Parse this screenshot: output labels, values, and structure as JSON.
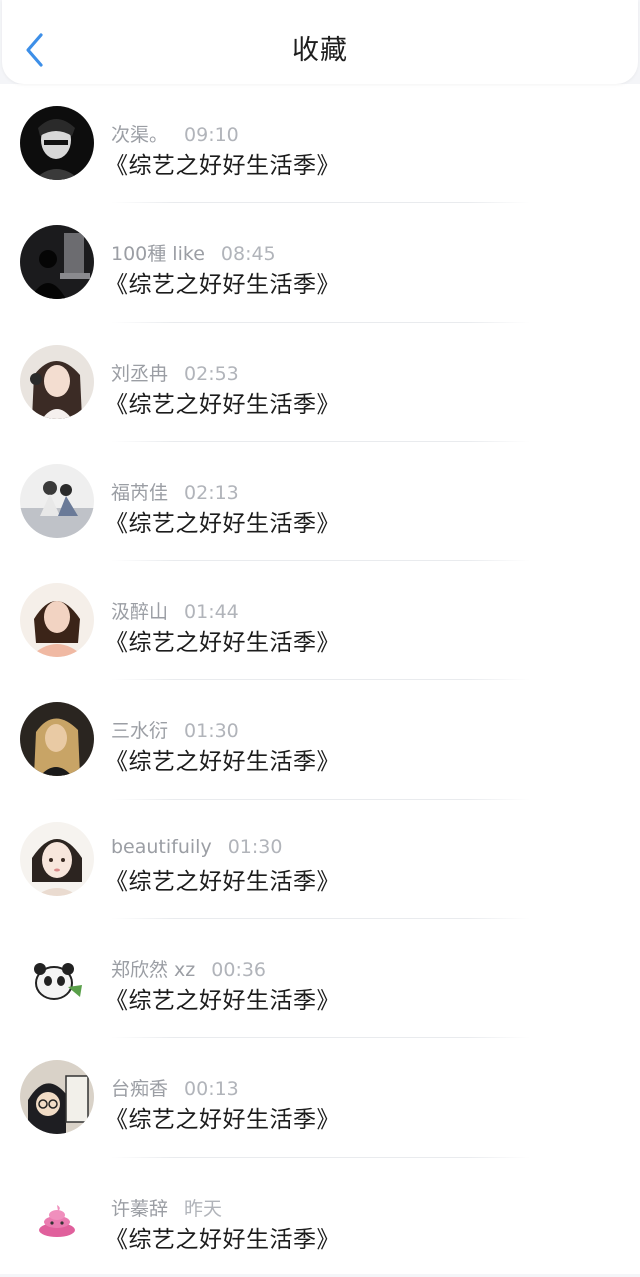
{
  "header": {
    "title": "收藏",
    "back_icon": "chevron-left-icon",
    "accent": "#3d8fe8"
  },
  "items": [
    {
      "name": "次渠。",
      "time": "09:10",
      "subject": "《综艺之好好生活季》",
      "avatar": "avatar-dark-boy"
    },
    {
      "name": "100種 like",
      "time": "08:45",
      "subject": "《综艺之好好生活季》",
      "avatar": "avatar-dark-silhouette"
    },
    {
      "name": "刘丞冉",
      "time": "02:53",
      "subject": "《综艺之好好生活季》",
      "avatar": "avatar-girl-headphones"
    },
    {
      "name": "福芮佳",
      "time": "02:13",
      "subject": "《综艺之好好生活季》",
      "avatar": "avatar-couple-sitting"
    },
    {
      "name": "汲醉山",
      "time": "01:44",
      "subject": "《综艺之好好生活季》",
      "avatar": "avatar-woman-smile"
    },
    {
      "name": "三水衍",
      "time": "01:30",
      "subject": "《综艺之好好生活季》",
      "avatar": "avatar-girl-dark"
    },
    {
      "name": "beautifuily",
      "time": "01:30",
      "subject": "《综艺之好好生活季》",
      "avatar": "avatar-anime-girl"
    },
    {
      "name": "郑欣然 xz",
      "time": "00:36",
      "subject": "《综艺之好好生活季》",
      "avatar": "avatar-panda"
    },
    {
      "name": "台痴香",
      "time": "00:13",
      "subject": "《综艺之好好生活季》",
      "avatar": "avatar-anime-boy-menu"
    },
    {
      "name": "许蓁辞",
      "time": "昨天",
      "subject": "《综艺之好好生活季》",
      "avatar": "avatar-pink-poop"
    }
  ]
}
